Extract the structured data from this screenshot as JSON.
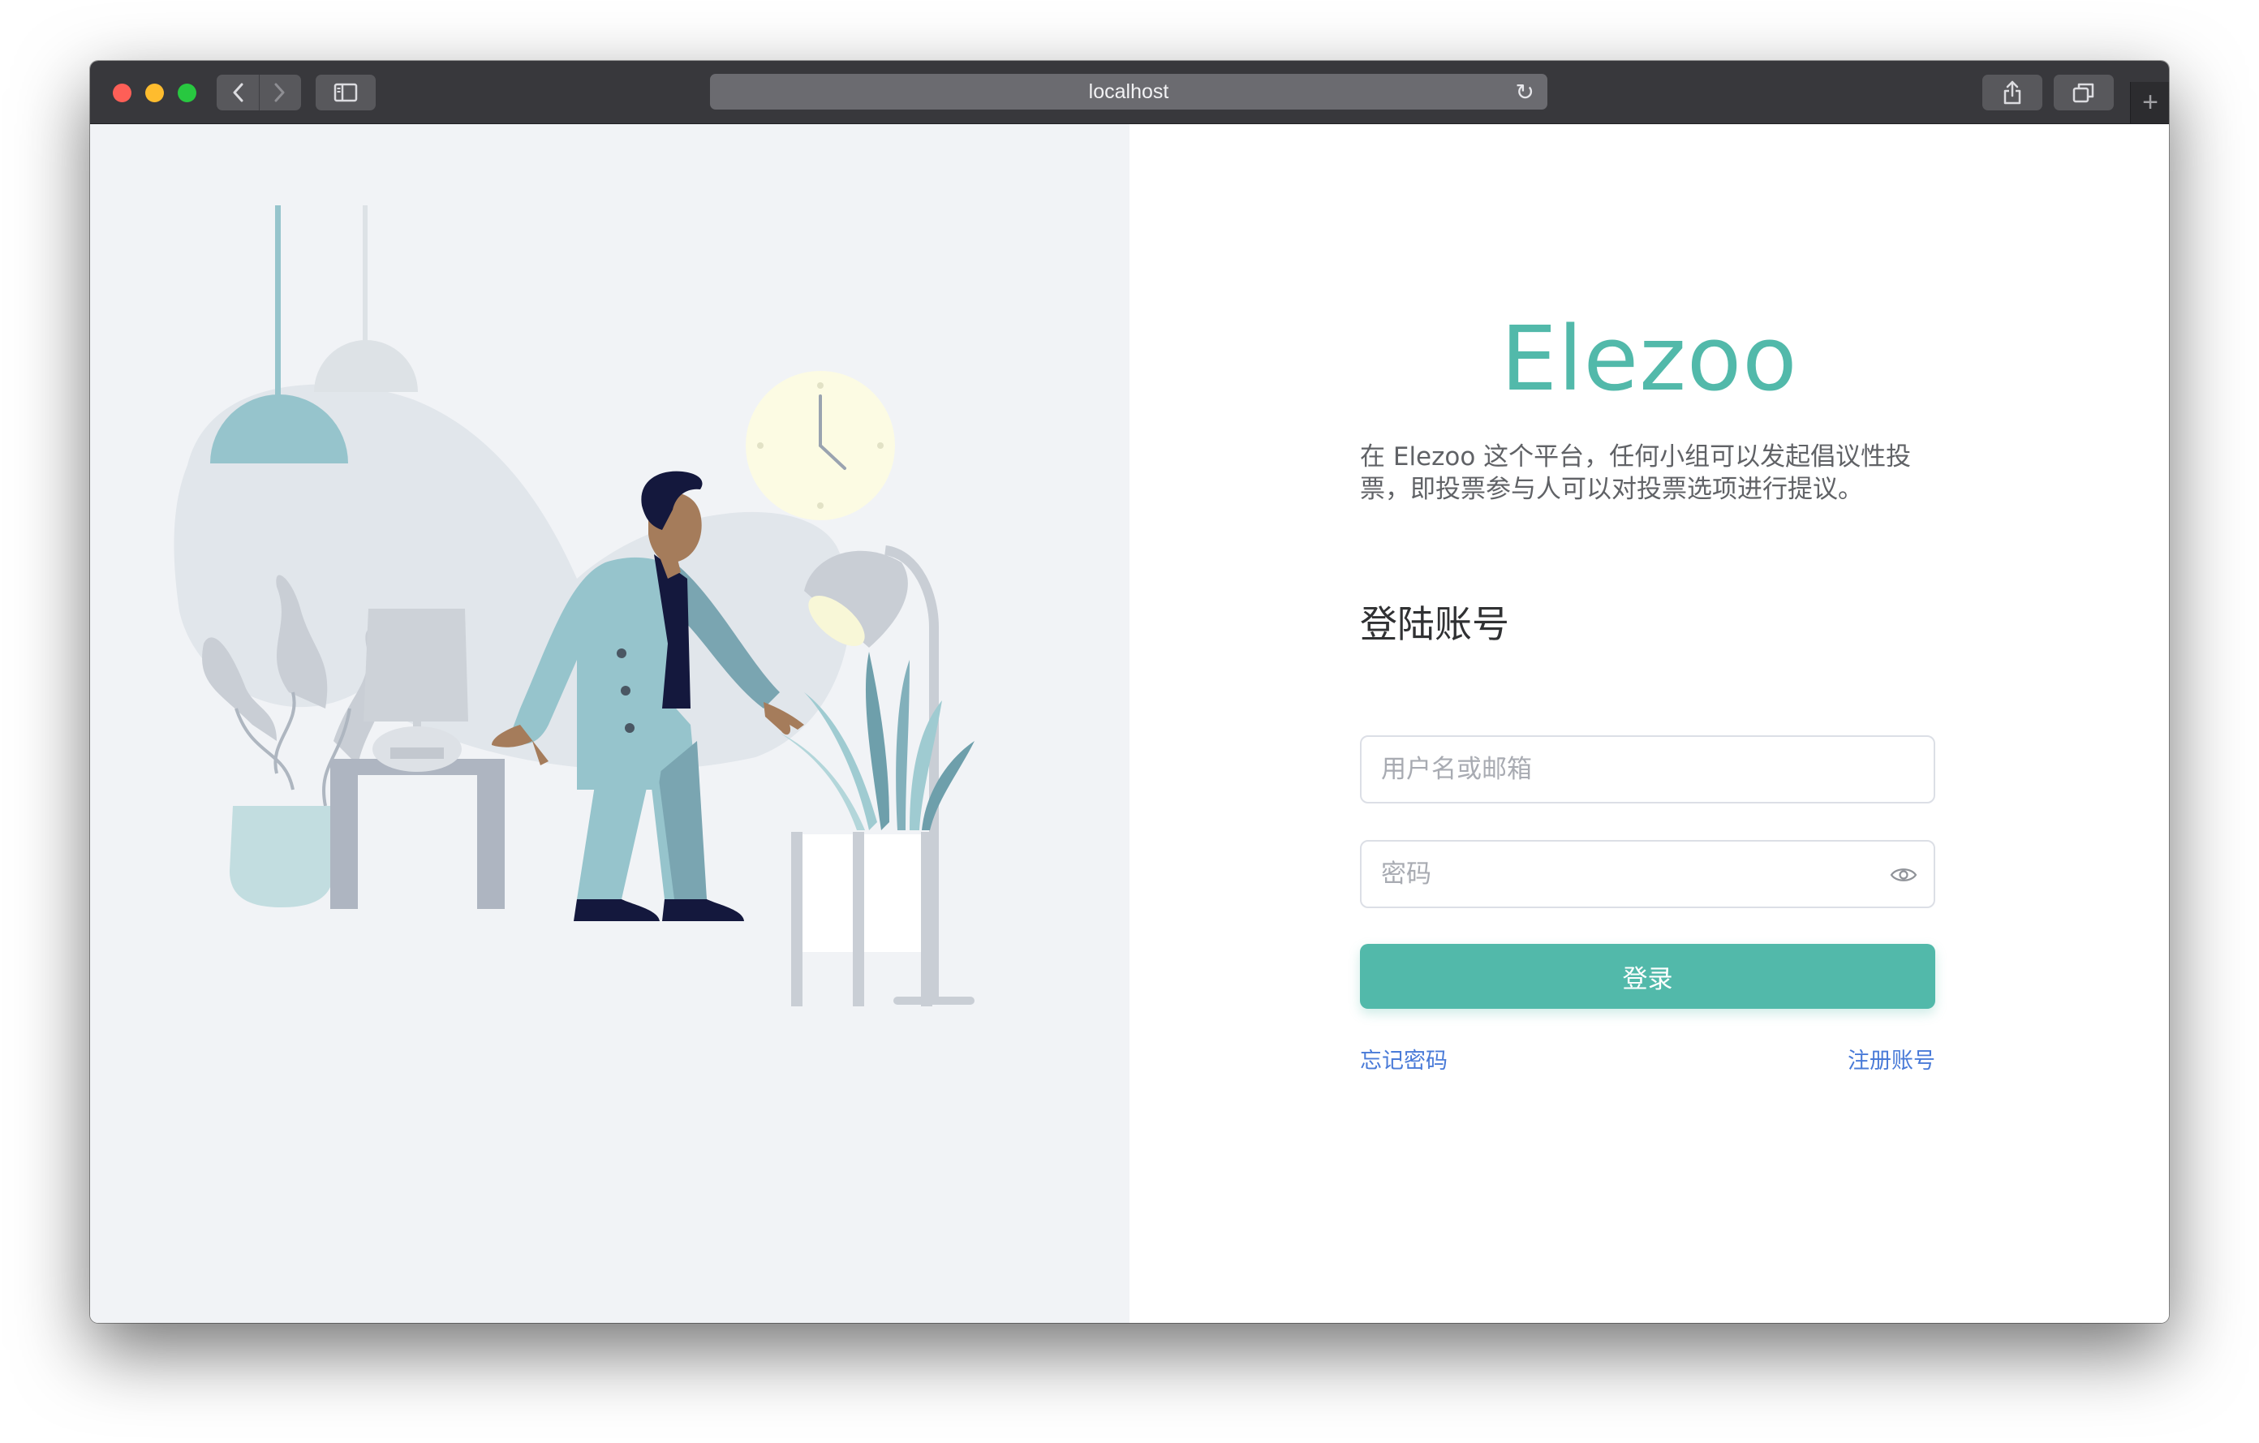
{
  "browser": {
    "address": "localhost",
    "icons": {
      "back": "chevron-left-icon",
      "forward": "chevron-right-icon",
      "sidebar": "sidebar-icon",
      "reload": "reload-icon",
      "share": "share-icon",
      "tabs": "tabs-icon",
      "new_tab": "plus-icon"
    },
    "glyphs": {
      "back": "‹",
      "forward": "›",
      "reload": "↻",
      "new_tab": "+"
    }
  },
  "login": {
    "brand": "Elezoo",
    "intro": "在 Elezoo 这个平台，任何小组可以发起倡议性投票，即投票参与人可以对投票选项进行提议。",
    "title": "登陆账号",
    "username_placeholder": "用户名或邮箱",
    "password_placeholder": "密码",
    "submit_label": "登录",
    "forgot_label": "忘记密码",
    "register_label": "注册账号"
  },
  "colors": {
    "accent": "#52b9aa",
    "link": "#4a7bd8",
    "left_background": "#f1f3f6",
    "titlebar": "#38383c"
  }
}
